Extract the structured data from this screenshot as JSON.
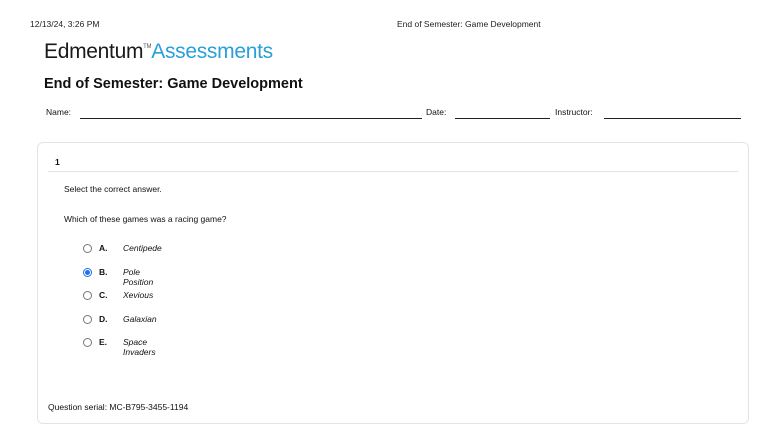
{
  "print_header": {
    "datetime": "12/13/24, 3:26 PM",
    "title": "End of Semester: Game Development"
  },
  "logo": {
    "brand": "Edmentum",
    "tm": "TM",
    "product": "Assessments",
    "brand_color": "#1a1a1a",
    "product_color": "#2a9fd8"
  },
  "document": {
    "title": "End of Semester: Game Development"
  },
  "info_fields": {
    "name_label": "Name:",
    "date_label": "Date:",
    "instructor_label": "Instructor:"
  },
  "question": {
    "number": "1",
    "instruction": "Select the correct answer.",
    "prompt": "Which of these games was a racing game?",
    "options": [
      {
        "letter": "A.",
        "text": "Centipede",
        "selected": false
      },
      {
        "letter": "B.",
        "text": "Pole Position",
        "selected": true
      },
      {
        "letter": "C.",
        "text": "Xevious",
        "selected": false
      },
      {
        "letter": "D.",
        "text": "Galaxian",
        "selected": false
      },
      {
        "letter": "E.",
        "text": "Space Invaders",
        "selected": false
      }
    ],
    "serial": "Question serial: MC-B795-3455-1194",
    "selected_color": "#1a73e8"
  }
}
